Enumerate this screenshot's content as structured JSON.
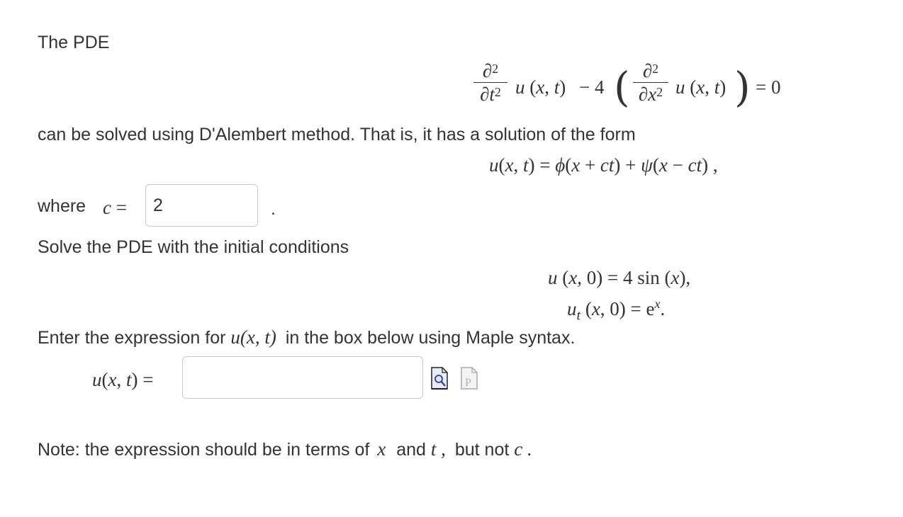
{
  "intro": {
    "lead": "The PDE"
  },
  "pde": {
    "d2": "∂2",
    "dt2": "∂t2",
    "dx2": "∂x2",
    "u": "u (x, t)",
    "minus_four": "− 4",
    "equals_zero": "= 0"
  },
  "solved_text": "can be solved using D'Alembert method. That is, it has a solution of the form",
  "solution_form": "u(x, t) = ϕ(x + ct) + ψ(x − ct) ,",
  "where": {
    "label": "where",
    "var": "c =",
    "value": "2",
    "trailing": "."
  },
  "solve_text": "Solve the PDE with the initial conditions",
  "initial_conditions": {
    "line1": "u (x, 0) = 4 sin (x),",
    "line2_lhs": "ut (x, 0) = e",
    "line2_exp": "x",
    "line2_end": "."
  },
  "enter_text": {
    "before": "Enter the expression for",
    "math": "u(x, t)",
    "after": "in the box below using Maple syntax."
  },
  "answer": {
    "label": "u(x, t) =",
    "value": ""
  },
  "note": {
    "prefix": "Note: the expression should be in terms of",
    "x": "x",
    "and": "and",
    "t": "t ,",
    "but": "but not",
    "c": "c ."
  },
  "icons": [
    "preview-icon",
    "maple-paste-icon"
  ]
}
